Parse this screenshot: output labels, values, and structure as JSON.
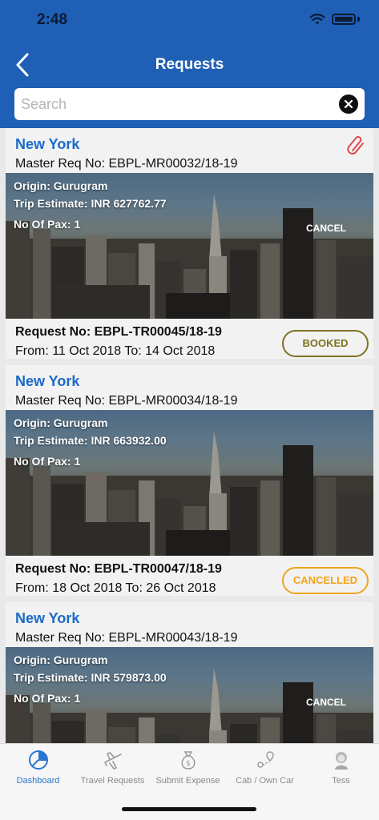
{
  "status_bar": {
    "time": "2:48"
  },
  "header": {
    "title": "Requests",
    "back_icon": "chevron-left-icon"
  },
  "search": {
    "placeholder": "Search",
    "value": ""
  },
  "requests": [
    {
      "city": "New York",
      "master_req": "Master Req No: EBPL-MR00032/18-19",
      "origin": "Origin: Gurugram",
      "trip_estimate": "Trip Estimate: INR 627762.77",
      "pax": "No Of Pax: 1",
      "cancel_label": "CANCEL",
      "request_no": "Request No: EBPL-TR00045/18-19",
      "dates": "From: 11 Oct 2018 To: 14 Oct 2018",
      "status": "BOOKED",
      "has_attachment": true
    },
    {
      "city": "New York",
      "master_req": "Master Req No: EBPL-MR00034/18-19",
      "origin": "Origin: Gurugram",
      "trip_estimate": "Trip Estimate: INR 663932.00",
      "pax": "No Of Pax: 1",
      "cancel_label": "",
      "request_no": "Request No: EBPL-TR00047/18-19",
      "dates": "From: 18 Oct 2018 To: 26 Oct 2018",
      "status": "CANCELLED",
      "has_attachment": false
    },
    {
      "city": "New York",
      "master_req": "Master Req No: EBPL-MR00043/18-19",
      "origin": "Origin: Gurugram",
      "trip_estimate": "Trip Estimate: INR 579873.00",
      "pax": "No Of Pax: 1",
      "cancel_label": "CANCEL",
      "has_attachment": false
    }
  ],
  "colors": {
    "header_bg": "#1f5fb6",
    "city": "#1a6ac9",
    "booked": "#7d7320",
    "cancelled": "#f0a41a",
    "attachment": "#e0494f",
    "tab_active": "#2a75d0"
  },
  "tabs": [
    {
      "label": "Dashboard",
      "icon": "pie-chart-icon",
      "active": true
    },
    {
      "label": "Travel Requests",
      "icon": "airplane-icon",
      "active": false
    },
    {
      "label": "Submit Expense",
      "icon": "money-bag-icon",
      "active": false
    },
    {
      "label": "Cab / Own Car",
      "icon": "route-pin-icon",
      "active": false
    },
    {
      "label": "Tess",
      "icon": "assistant-avatar-icon",
      "active": false
    }
  ]
}
